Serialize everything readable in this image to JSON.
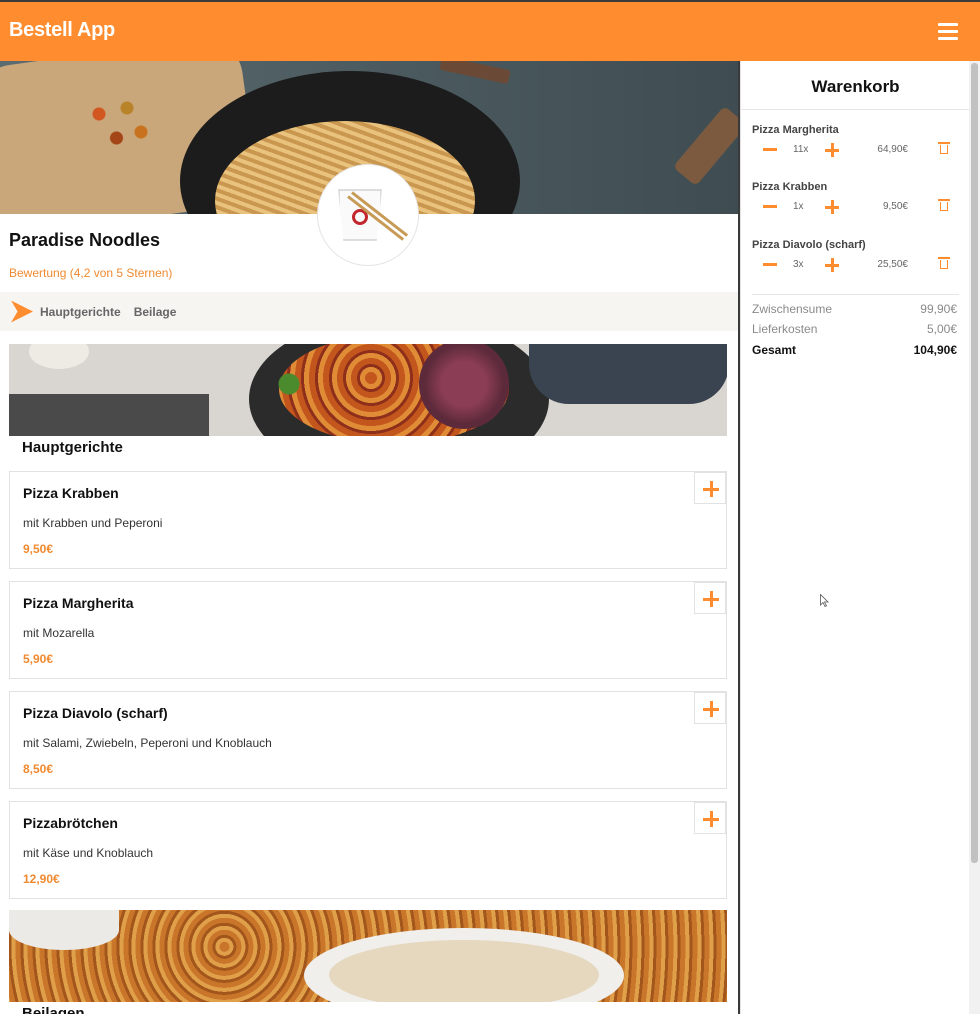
{
  "app": {
    "logo": "Bestell App"
  },
  "restaurant": {
    "name": "Paradise Noodles",
    "rating": "Bewertung (4,2 von 5 Sternen)"
  },
  "categories": [
    "Hauptgerichte",
    "Beilage"
  ],
  "sections": {
    "main_title": "Hauptgerichte",
    "side_title": "Beilagen"
  },
  "dishes": [
    {
      "name": "Pizza Krabben",
      "desc": "mit Krabben und Peperoni",
      "price": "9,50€"
    },
    {
      "name": "Pizza Margherita",
      "desc": "mit Mozarella",
      "price": "5,90€"
    },
    {
      "name": "Pizza Diavolo (scharf)",
      "desc": "mit Salami, Zwiebeln, Peperoni und Knoblauch",
      "price": "8,50€"
    },
    {
      "name": "Pizzabrötchen",
      "desc": "mit Käse und Knoblauch",
      "price": "12,90€"
    }
  ],
  "cart": {
    "title": "Warenkorb",
    "items": [
      {
        "name": "Pizza Margherita",
        "qty": "11x",
        "price": "64,90€"
      },
      {
        "name": "Pizza Krabben",
        "qty": "1x",
        "price": "9,50€"
      },
      {
        "name": "Pizza Diavolo (scharf)",
        "qty": "3x",
        "price": "25,50€"
      }
    ],
    "subtotal_label": "Zwischensume",
    "subtotal": "99,90€",
    "delivery_label": "Lieferkosten",
    "delivery": "5,00€",
    "total_label": "Gesamt",
    "total": "104,90€"
  },
  "colors": {
    "accent": "#ff8c2e",
    "price": "#f08a30"
  },
  "icons": [
    "menu-icon",
    "arrow-right-icon",
    "plus-icon",
    "minus-icon",
    "trash-icon",
    "mouse-pointer-icon"
  ]
}
